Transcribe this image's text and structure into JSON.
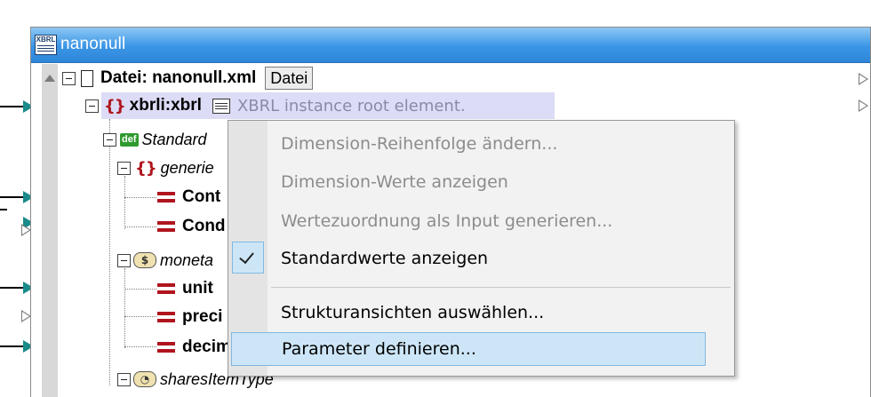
{
  "component": {
    "title": "nanonull",
    "title_icon_text": "XBRL"
  },
  "tree": {
    "file_label": "Datei: nanonull.xml",
    "file_button": "Datei",
    "root_element": "xbrli:xbrl",
    "root_annotation": "XBRL instance root element.",
    "standard_item": "Standard",
    "generic_item": "generie",
    "cont_item": "Cont",
    "cond_item": "Cond",
    "monetary_item": "moneta",
    "unit_item": "unit",
    "precision_item": "preci",
    "decimals_item": "decim",
    "shares_item": "sharesItemType",
    "def_icon": "def",
    "monetary_icon": "$",
    "braces_icon": "{}"
  },
  "context_menu": {
    "items": [
      {
        "label": "Dimension-Reihenfolge ändern...",
        "enabled": false
      },
      {
        "label": "Dimension-Werte anzeigen",
        "enabled": false
      },
      {
        "label": "Wertezuordnung als Input generieren...",
        "enabled": false
      },
      {
        "label": "Standardwerte anzeigen",
        "enabled": true,
        "checked": true
      },
      {
        "label": "Strukturansichten auswählen...",
        "enabled": true
      },
      {
        "label": "Parameter definieren...",
        "enabled": true,
        "selected": true
      }
    ]
  },
  "colors": {
    "titlebar": "#3a95e6",
    "port": "#1a8a8a",
    "element_red": "#b0141e",
    "selection": "#cde6f7",
    "highlight": "#dcdcf6"
  }
}
